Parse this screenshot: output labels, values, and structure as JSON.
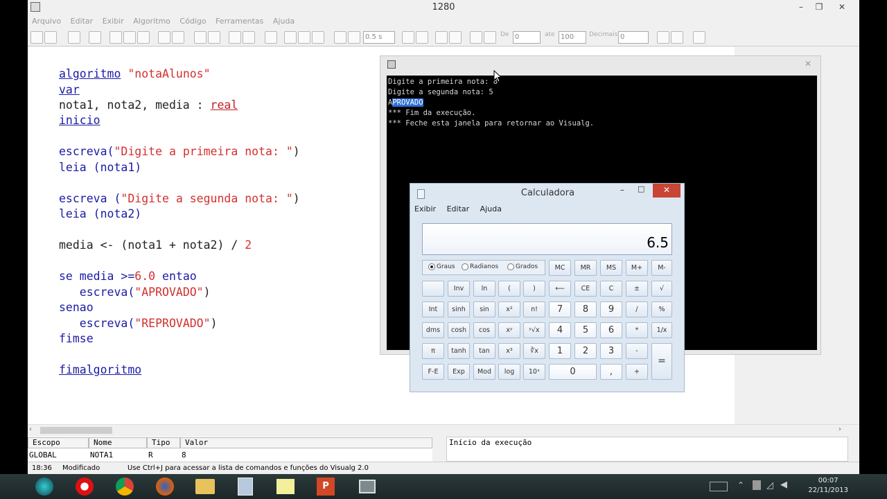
{
  "window": {
    "title": "1280"
  },
  "menu": [
    "Arquivo",
    "Editar",
    "Exibir",
    "Algoritmo",
    "Código",
    "Ferramentas",
    "Ajuda"
  ],
  "toolbar": {
    "speed": "0.5 s",
    "de_label": "De",
    "de_value": "0",
    "ate_label": "ate",
    "ate_value": "100",
    "decimais_label": "Decimais",
    "decimais_value": "0"
  },
  "code": {
    "l1_kw": "algoritmo",
    "l1_str": "\"notaAlunos\"",
    "l2": "var",
    "l3_a": "nota1, nota2, media : ",
    "l3_type": "real",
    "l4": "inicio",
    "l5_a": "escreva(",
    "l5_str": "\"Digite a primeira nota: \"",
    "l5_b": ")",
    "l6": "leia (nota1)",
    "l7_a": "escreva (",
    "l7_str": "\"Digite a segunda nota: \"",
    "l7_b": ")",
    "l8": "leia (nota2)",
    "l9_a": "media <- (nota1 + nota2) / ",
    "l9_num": "2",
    "l10_a": "se media >=",
    "l10_num": "6.0",
    "l10_b": " entao",
    "l11_a": "   escreva(",
    "l11_str": "\"APROVADO\"",
    "l11_b": ")",
    "l12": "senao",
    "l13_a": "   escreva(",
    "l13_str": "\"REPROVADO\"",
    "l13_b": ")",
    "l14": "fimse",
    "l15": "fimalgoritmo"
  },
  "variables": {
    "headers": [
      "Escopo",
      "Nome",
      "Tipo",
      "Valor"
    ],
    "row": [
      "GLOBAL",
      "NOTA1",
      "R",
      "8"
    ]
  },
  "output": {
    "text": "Início da execução"
  },
  "status": {
    "position": "18:36",
    "state": "Modificado",
    "hint": "Use Ctrl+J para acessar a lista de comandos e funções do Visualg 2.0"
  },
  "console": {
    "line1": "Digite a primeira nota: 8",
    "line2": "Digite a segunda nota: 5",
    "line3_a": "A",
    "line3_sel": "PROVADO",
    "line4": "*** Fim da execução.",
    "line5": "*** Feche esta janela para retornar ao Visualg."
  },
  "calculator": {
    "title": "Calculadora",
    "menu": [
      "Exibir",
      "Editar",
      "Ajuda"
    ],
    "display": "6.5",
    "radios": [
      "Graus",
      "Radianos",
      "Grados"
    ],
    "buttons": {
      "mc": "MC",
      "mr": "MR",
      "ms": "MS",
      "mplus": "M+",
      "mminus": "M-",
      "inv": "Inv",
      "ln": "ln",
      "lparen": "(",
      "rparen": ")",
      "back": "⟵",
      "ce": "CE",
      "c": "C",
      "pm": "±",
      "sqrt": "√",
      "int": "Int",
      "sinh": "sinh",
      "sin": "sin",
      "x2": "x²",
      "nfact": "n!",
      "d7": "7",
      "d8": "8",
      "d9": "9",
      "div": "/",
      "pct": "%",
      "dms": "dms",
      "cosh": "cosh",
      "cos": "cos",
      "xy": "xʸ",
      "yroot": "ʸ√x",
      "d4": "4",
      "d5": "5",
      "d6": "6",
      "mul": "*",
      "recip": "1/x",
      "pi": "π",
      "tanh": "tanh",
      "tan": "tan",
      "x3": "x³",
      "root3": "∛x",
      "d1": "1",
      "d2": "2",
      "d3": "3",
      "sub": "-",
      "eq": "=",
      "fe": "F-E",
      "exp": "Exp",
      "mod": "Mod",
      "log": "log",
      "pow10": "10ˣ",
      "d0": "0",
      "dot": ",",
      "add": "+"
    }
  },
  "clock": {
    "time": "00:07",
    "date": "22/11/2013"
  }
}
